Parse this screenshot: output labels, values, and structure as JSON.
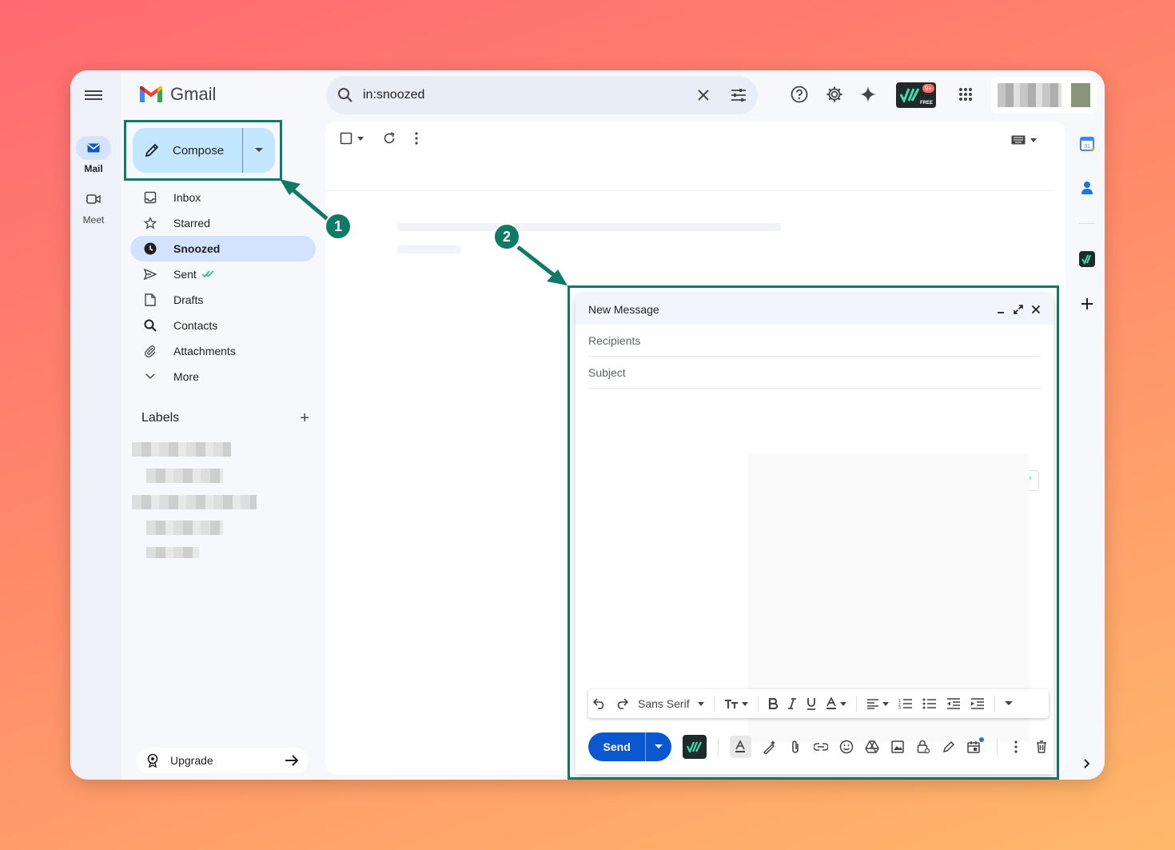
{
  "app": {
    "name": "Gmail"
  },
  "rail": {
    "mail_label": "Mail",
    "meet_label": "Meet"
  },
  "compose": {
    "label": "Compose"
  },
  "nav": {
    "inbox": "Inbox",
    "starred": "Starred",
    "snoozed": "Snoozed",
    "sent": "Sent",
    "drafts": "Drafts",
    "contacts": "Contacts",
    "attachments": "Attachments",
    "more": "More"
  },
  "labels": {
    "title": "Labels"
  },
  "upgrade": {
    "label": "Upgrade"
  },
  "search": {
    "value": "in:snoozed"
  },
  "extension": {
    "badge_count": "9+",
    "badge_text": "FREE"
  },
  "calendar": {
    "day": "31"
  },
  "dialog": {
    "title": "New Message",
    "recipients_placeholder": "Recipients",
    "subject_placeholder": "Subject",
    "font_name": "Sans Serif",
    "send_label": "Send"
  },
  "annotations": {
    "step1": "1",
    "step2": "2"
  },
  "colors": {
    "accent": "#0f7a66",
    "compose_bg": "#c2e7ff",
    "active_nav": "#d3e3fd",
    "send_blue": "#0b57d0"
  }
}
